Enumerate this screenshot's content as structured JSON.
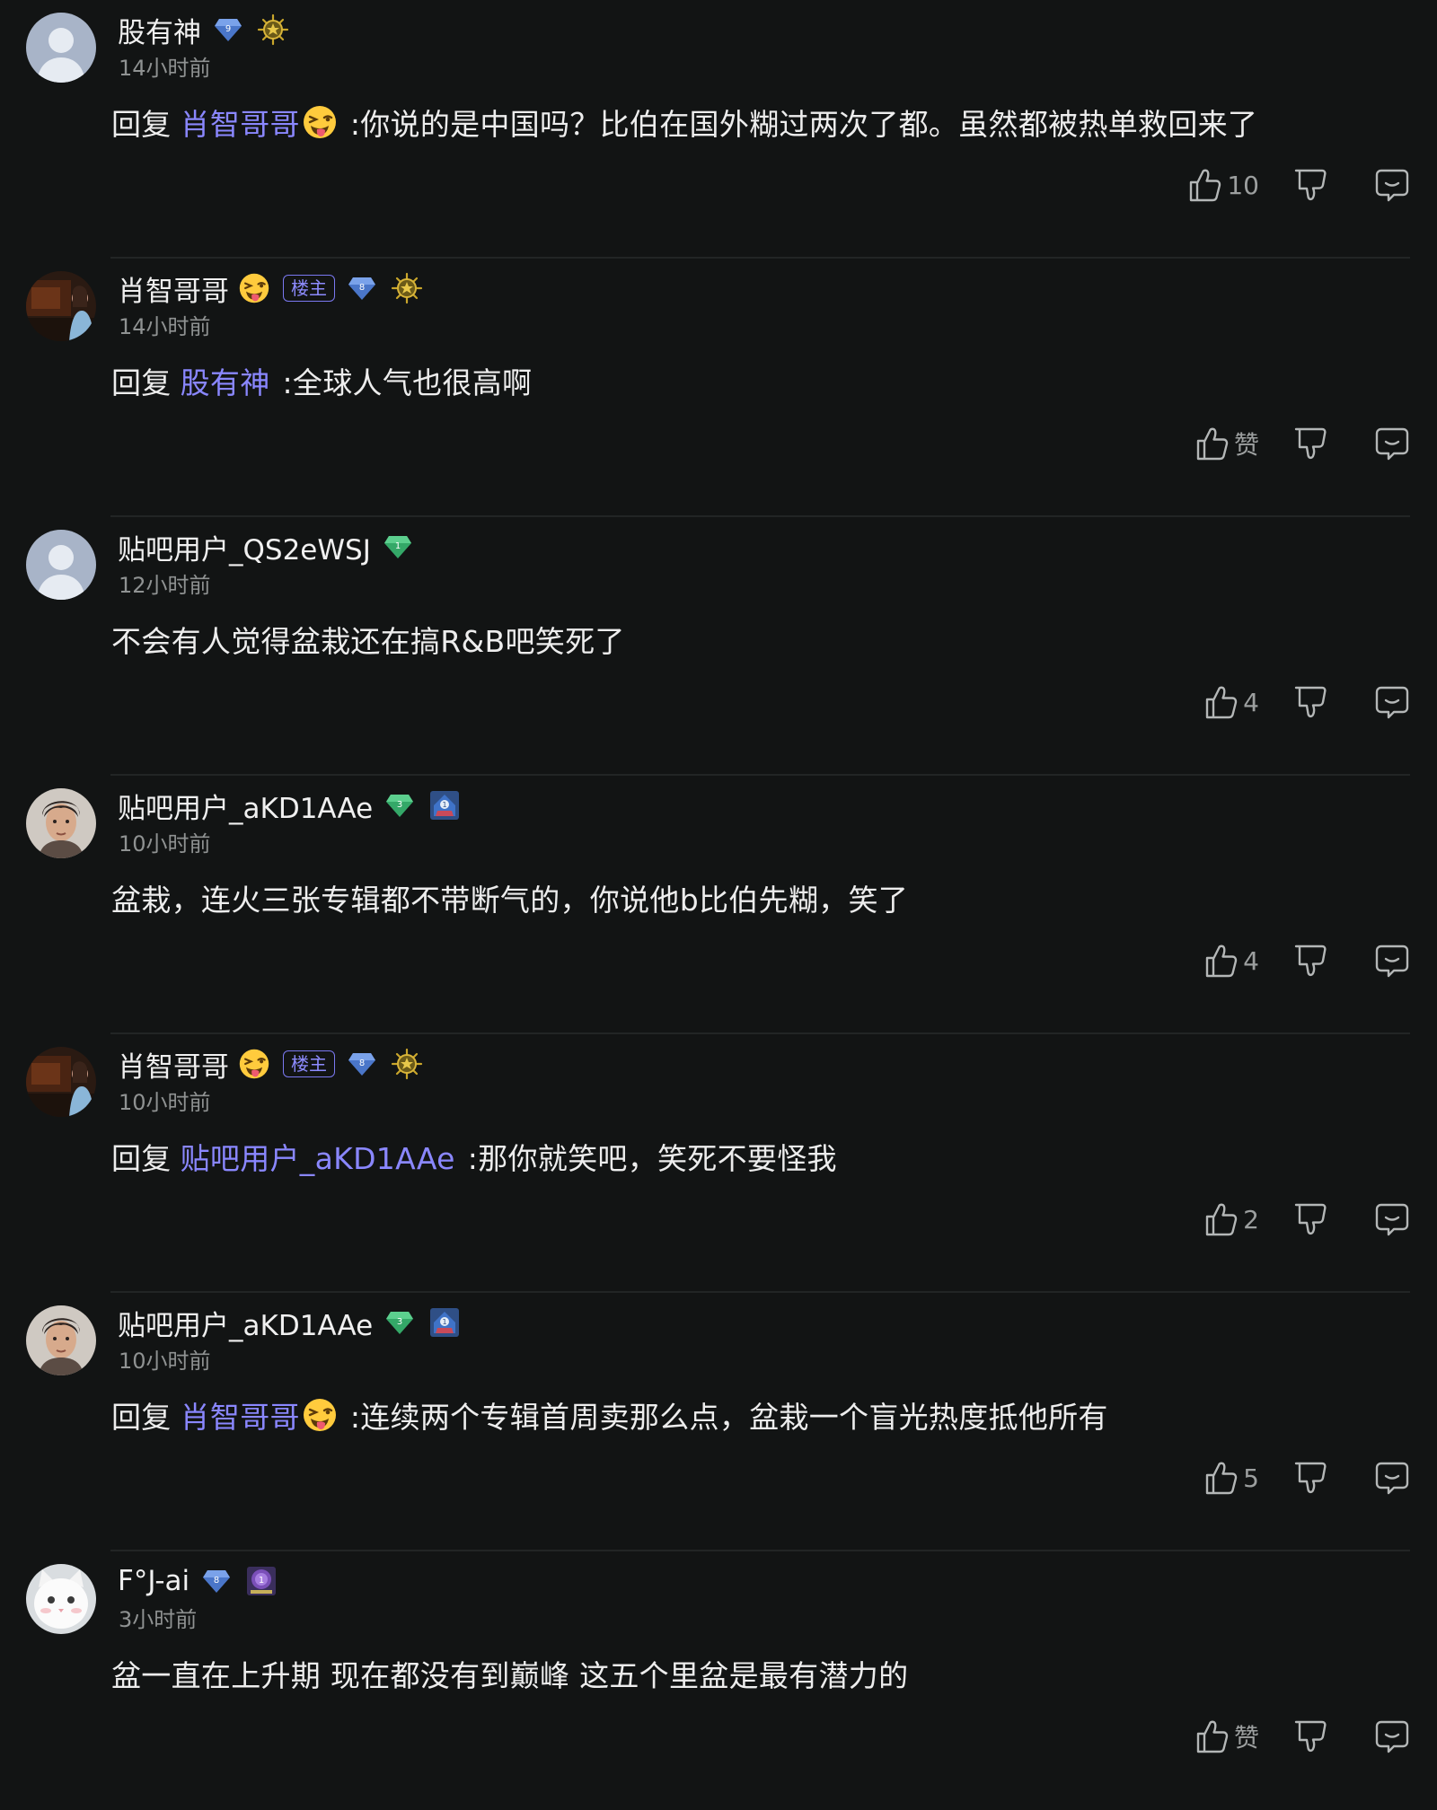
{
  "ui": {
    "reply_prefix": "回复",
    "op_tag": "楼主",
    "colors": {
      "background": "#121414",
      "text": "#ededed",
      "mention": "#8a87ff",
      "time": "#8f9292",
      "divider": "#222525",
      "level_blue": "#4a76c9",
      "level_green": "#34a868"
    }
  },
  "comments": [
    {
      "username": "股有神",
      "avatar": "default-gray-avatar",
      "name_emoji": false,
      "is_op": false,
      "level": "9",
      "level_color": "blue",
      "badge": "gold-medal-badge",
      "time": "14小时前",
      "reply_to": "肖智哥哥",
      "reply_to_emoji": true,
      "text": ":你说的是中国吗？比伯在国外糊过两次了都。虽然都被热单救回来了",
      "like_label": "10"
    },
    {
      "username": "肖智哥哥",
      "avatar": "dark-room-photo-avatar",
      "name_emoji": true,
      "is_op": true,
      "level": "8",
      "level_color": "blue",
      "badge": "gold-medal-badge",
      "time": "14小时前",
      "reply_to": "股有神",
      "reply_to_emoji": false,
      "text": ":全球人气也很高啊",
      "like_label": "赞"
    },
    {
      "username": "贴吧用户_QS2eWSJ",
      "avatar": "default-gray-avatar",
      "name_emoji": false,
      "is_op": false,
      "level": "1",
      "level_color": "green",
      "badge": "",
      "time": "12小时前",
      "reply_to": "",
      "reply_to_emoji": false,
      "text": "不会有人觉得盆栽还在搞R&B吧笑死了",
      "like_label": "4"
    },
    {
      "username": "贴吧用户_aKD1AAe",
      "avatar": "male-portrait-avatar",
      "name_emoji": false,
      "is_op": false,
      "level": "3",
      "level_color": "green",
      "badge": "blue-rank-badge",
      "time": "10小时前",
      "reply_to": "",
      "reply_to_emoji": false,
      "text": "盆栽，连火三张专辑都不带断气的，你说他b比伯先糊，笑了",
      "like_label": "4"
    },
    {
      "username": "肖智哥哥",
      "avatar": "dark-room-photo-avatar",
      "name_emoji": true,
      "is_op": true,
      "level": "8",
      "level_color": "blue",
      "badge": "gold-medal-badge",
      "time": "10小时前",
      "reply_to": "贴吧用户_aKD1AAe",
      "reply_to_emoji": false,
      "text": ":那你就笑吧，笑死不要怪我",
      "like_label": "2"
    },
    {
      "username": "贴吧用户_aKD1AAe",
      "avatar": "male-portrait-avatar",
      "name_emoji": false,
      "is_op": false,
      "level": "3",
      "level_color": "green",
      "badge": "blue-rank-badge",
      "time": "10小时前",
      "reply_to": "肖智哥哥",
      "reply_to_emoji": true,
      "text": ":连续两个专辑首周卖那么点，盆栽一个盲光热度抵他所有",
      "like_label": "5"
    },
    {
      "username": "F°J-ai",
      "avatar": "white-cat-avatar",
      "name_emoji": false,
      "is_op": false,
      "level": "8",
      "level_color": "blue",
      "badge": "purple-rank-badge",
      "time": "3小时前",
      "reply_to": "",
      "reply_to_emoji": false,
      "text": "盆一直在上升期 现在都没有到巅峰 这五个里盆是最有潜力的",
      "like_label": "赞"
    }
  ]
}
